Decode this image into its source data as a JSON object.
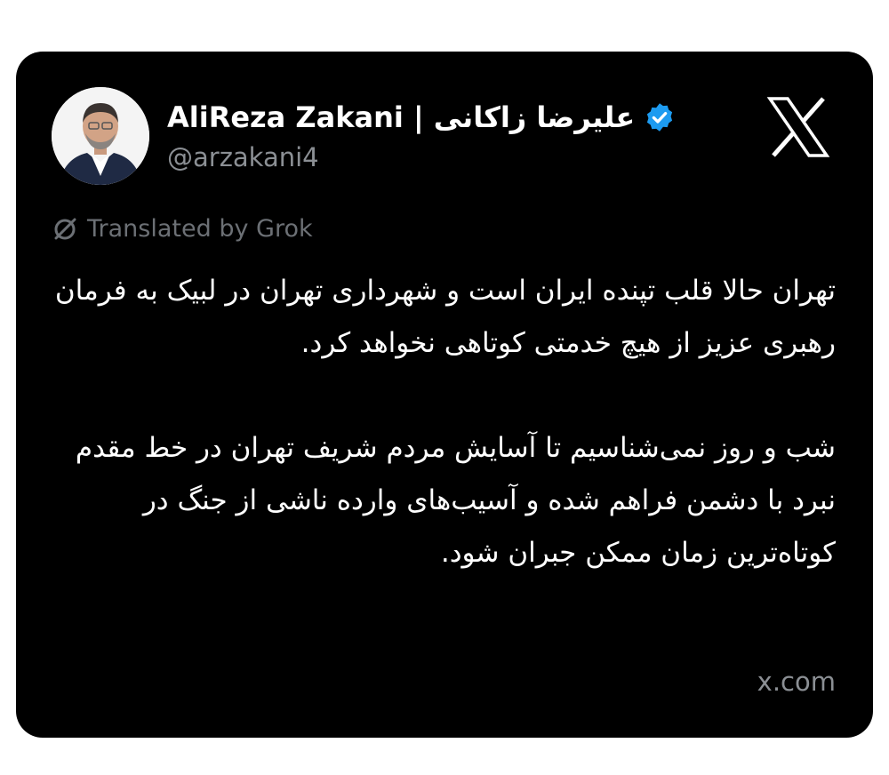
{
  "tweet": {
    "author": {
      "display_name": "AliReza Zakani | علیرضا زاکانی",
      "handle": "@arzakani4",
      "verified": true,
      "verified_color": "#1d9bf0"
    },
    "platform_icon": "x-logo-icon",
    "translation_notice": "Translated by Grok",
    "paragraphs": [
      "تهران حالا قلب تپنده ایران است و شهرداری تهران در لبیک به فرمان رهبری عزیز از هیچ خدمتی کوتاهی نخواهد کرد.",
      "شب و روز نمی‌شناسیم تا آسایش مردم شریف تهران در خط مقدم نبرد با دشمن فراهم شده و آسیب‌های وارده ناشی از جنگ در کوتاه‌ترین زمان ممکن جبران شود."
    ],
    "source": "x.com"
  },
  "colors": {
    "card_background": "#000000",
    "page_background": "#ffffff",
    "primary_text": "#ffffff",
    "secondary_text": "#8b8f94"
  }
}
